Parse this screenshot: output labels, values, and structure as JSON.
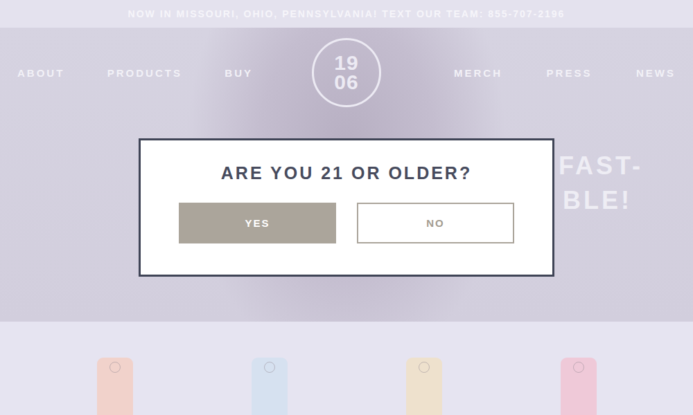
{
  "banner": {
    "text": "NOW IN MISSOURI, OHIO, PENNSYLVANIA! TEXT OUR TEAM: 855-707-2196"
  },
  "nav": {
    "left": [
      {
        "label": "ABOUT"
      },
      {
        "label": "PRODUCTS"
      },
      {
        "label": "BUY"
      }
    ],
    "logo": {
      "top": "19",
      "bottom": "06"
    },
    "right": [
      {
        "label": "MERCH"
      },
      {
        "label": "PRESS"
      },
      {
        "label": "NEWS"
      }
    ]
  },
  "hero": {
    "headline_lines": [
      "FAST-",
      "BLE!"
    ]
  },
  "products": [
    {
      "color": "#f1d2cb"
    },
    {
      "color": "#d6e1f0"
    },
    {
      "color": "#eee1cd"
    },
    {
      "color": "#efc9d8"
    }
  ],
  "age_gate": {
    "question": "ARE YOU 21 OR OLDER?",
    "buttons": [
      {
        "label": "YES",
        "kind": "primary"
      },
      {
        "label": "NO",
        "kind": "secondary"
      }
    ]
  }
}
